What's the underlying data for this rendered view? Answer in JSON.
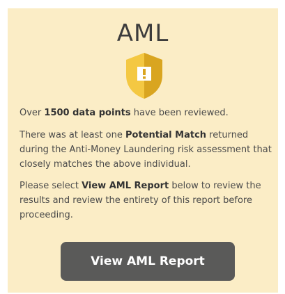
{
  "card": {
    "title": "AML",
    "icon": "warning-shield-icon",
    "paragraph1": {
      "before": "Over ",
      "bold": "1500 data points",
      "after": " have been reviewed."
    },
    "paragraph2": {
      "before": "There was at least one ",
      "bold": "Potential Match",
      "after": " returned during the Anti-Money Laundering risk assessment that closely matches the above individual."
    },
    "paragraph3": {
      "before": "Please select ",
      "bold": "View AML Report",
      "after": " below to review the results and review the entirety of this report before proceeding."
    },
    "button_label": "View AML Report"
  },
  "colors": {
    "card_background": "#fbedc6",
    "shield_light": "#f4c842",
    "shield_dark": "#d9a520",
    "button_background": "#5a5a59"
  }
}
